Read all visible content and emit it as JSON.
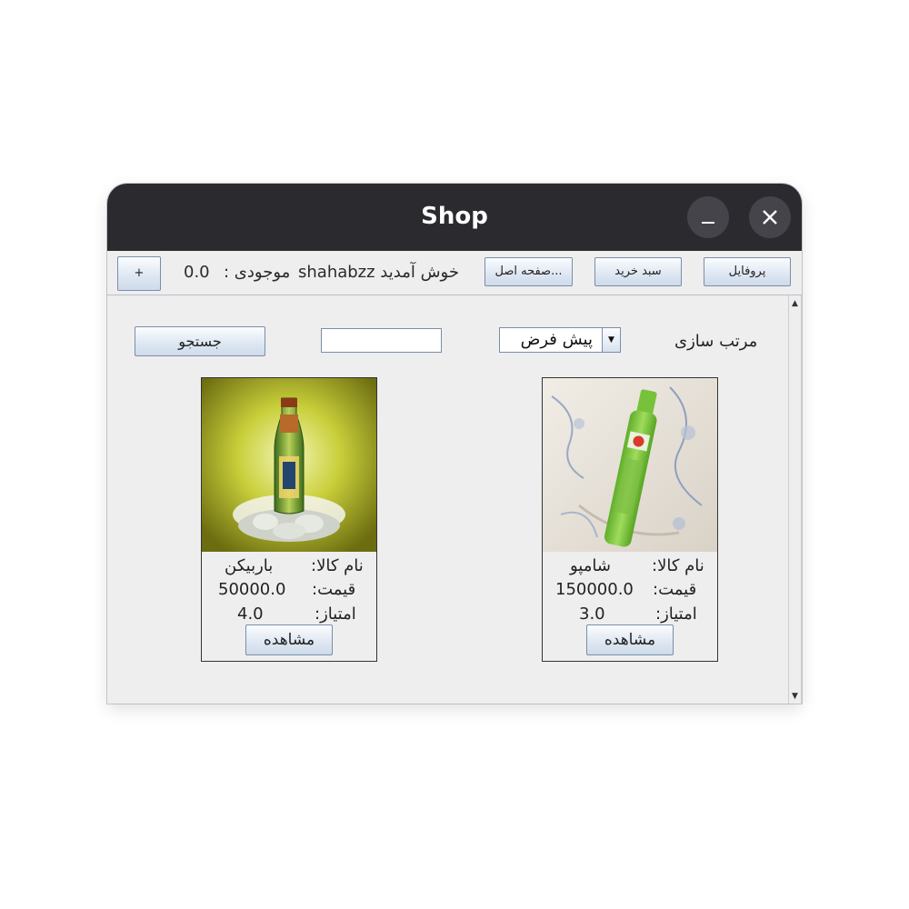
{
  "window": {
    "title": "Shop"
  },
  "toolbar": {
    "profile_label": "پروفایل",
    "cart_label": "سبد خرید",
    "home_label": "صفحه اصل...",
    "welcome_text": "خوش آمدید shahabzz",
    "balance_label": "موجودی :",
    "balance_value": "0.0",
    "add_label": "+"
  },
  "filters": {
    "sort_label": "مرتب سازی",
    "sort_selected": "پیش فرض",
    "search_value": "",
    "search_label": "جستجو"
  },
  "products": [
    {
      "name_label": "نام کالا:",
      "name": "باربیکن",
      "price_label": "قیمت:",
      "price": "50000.0",
      "rating_label": "امتیاز:",
      "rating": "4.0",
      "view_label": "مشاهده"
    },
    {
      "name_label": "نام کالا:",
      "name": "شامپو",
      "price_label": "قیمت:",
      "price": "150000.0",
      "rating_label": "امتیاز:",
      "rating": "3.0",
      "view_label": "مشاهده"
    }
  ]
}
